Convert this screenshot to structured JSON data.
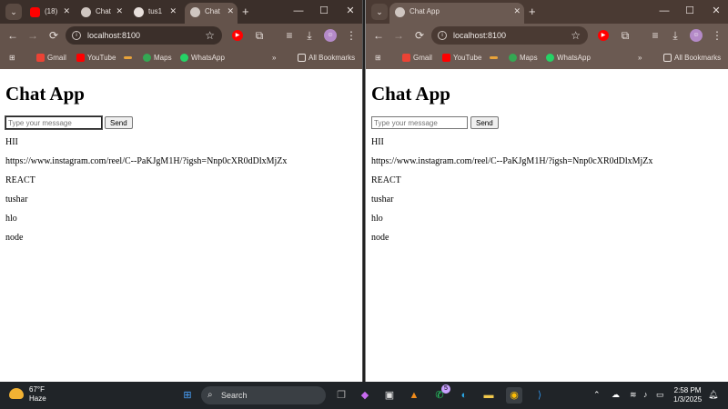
{
  "left_window": {
    "tabs": [
      {
        "label": "(18)",
        "favicon": "youtube-icon"
      },
      {
        "label": "Chat",
        "favicon": "globe-icon"
      },
      {
        "label": "tus1",
        "favicon": "github-icon"
      },
      {
        "label": "Chat",
        "favicon": "globe-icon",
        "active": true
      }
    ],
    "address": "localhost:8100",
    "bookmarks": [
      "Gmail",
      "YouTube",
      "Maps",
      "WhatsApp"
    ],
    "all_bookmarks": "All Bookmarks",
    "page": {
      "title": "Chat App",
      "input_placeholder": "Type your message",
      "send_label": "Send",
      "messages": [
        "HII",
        "https://www.instagram.com/reel/C--PaKJgM1H/?igsh=Nnp0cXR0dDlxMjZx",
        "REACT",
        "tushar",
        "hlo",
        "node"
      ]
    }
  },
  "right_window": {
    "tabs": [
      {
        "label": "Chat App",
        "favicon": "globe-icon",
        "active": true
      }
    ],
    "address": "localhost:8100",
    "bookmarks": [
      "Gmail",
      "YouTube",
      "Maps",
      "WhatsApp"
    ],
    "all_bookmarks": "All Bookmarks",
    "page": {
      "title": "Chat App",
      "input_placeholder": "Type your message",
      "send_label": "Send",
      "messages": [
        "HII",
        "https://www.instagram.com/reel/C--PaKJgM1H/?igsh=Nnp0cXR0dDlxMjZx",
        "REACT",
        "tushar",
        "hlo",
        "node"
      ]
    }
  },
  "taskbar": {
    "weather_temp": "67°F",
    "weather_desc": "Haze",
    "search_placeholder": "Search",
    "whatsapp_badge": "5",
    "time": "2:58 PM",
    "date": "1/3/2025"
  },
  "colors": {
    "chrome_dark": "#3b2f2a",
    "chrome_toolbar": "#64534b",
    "taskbar": "#202428",
    "youtube_red": "#ff0000"
  }
}
